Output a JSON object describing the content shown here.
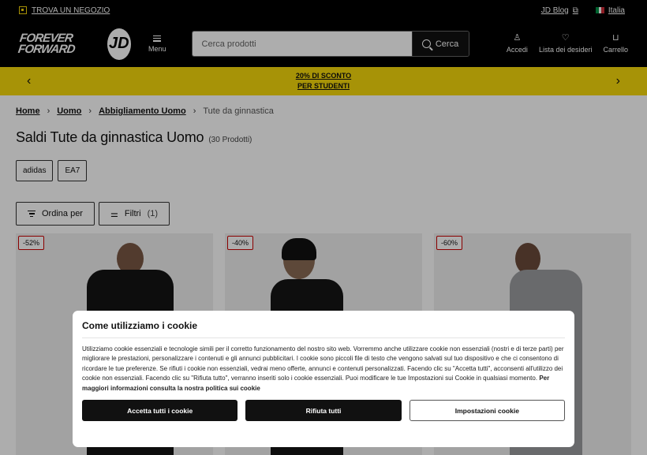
{
  "topbar": {
    "store_label": "TROVA UN NEGOZIO",
    "blog_label": "JD Blog",
    "country_label": "Italia"
  },
  "header": {
    "logo_text": "FOREVER FORWARD",
    "logo_badge": "JD",
    "menu_label": "Menu",
    "search_placeholder": "Cerca prodotti",
    "search_button": "Cerca",
    "account_label": "Accedi",
    "wishlist_label": "Lista dei desideri",
    "cart_label": "Carrello"
  },
  "promo": {
    "line1": "20% DI SCONTO",
    "line2": "PER STUDENTI"
  },
  "breadcrumb": [
    "Home",
    "Uomo",
    "Abbigliamento Uomo",
    "Tute da ginnastica"
  ],
  "page": {
    "title": "Saldi Tute da ginnastica Uomo",
    "count": "(30 Prodotti)"
  },
  "brands": [
    "adidas",
    "EA7"
  ],
  "controls": {
    "sort_label": "Ordina per",
    "filter_label": "Filtri",
    "filter_count": "(1)"
  },
  "products": [
    {
      "badge": "-52%"
    },
    {
      "badge": "-40%"
    },
    {
      "badge": "-60%"
    }
  ],
  "cookie": {
    "title": "Come utilizziamo i cookie",
    "body": "Utilizziamo cookie essenziali e tecnologie simili per il corretto funzionamento del nostro sito web. Vorremmo anche utilizzare cookie non essenziali (nostri e di terze parti) per migliorare le prestazioni, personalizzare i contenuti e gli annunci pubblicitari. I cookie sono piccoli file di testo che vengono salvati sul tuo dispositivo e che ci consentono di ricordare le tue preferenze. Se rifiuti i cookie non essenziali, vedrai meno offerte, annunci e contenuti personalizzati. Facendo clic su \"Accetta tutti\", acconsenti all'utilizzo dei cookie non essenziali. Facendo clic su \"Rifiuta tutto\", verranno inseriti solo i cookie essenziali. Puoi modificare le tue Impostazioni sui Cookie in qualsiasi momento.",
    "link": "Per maggiori informazioni consulta la nostra politica sui cookie",
    "accept": "Accetta tutti i cookie",
    "reject": "Rifiuta tutti",
    "settings": "Impostazioni cookie"
  }
}
